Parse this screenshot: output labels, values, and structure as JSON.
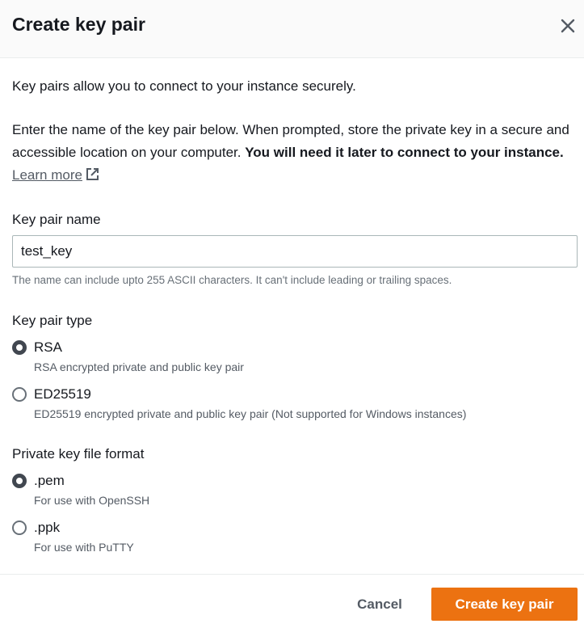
{
  "dialog": {
    "title": "Create key pair",
    "intro": "Key pairs allow you to connect to your instance securely.",
    "description_plain": "Enter the name of the key pair below. When prompted, store the private key in a secure and accessible location on your computer. ",
    "description_bold": "You will need it later to connect to your instance.",
    "learn_more": "Learn more"
  },
  "key_pair_name": {
    "label": "Key pair name",
    "value": "test_key",
    "hint": "The name can include upto 255 ASCII characters. It can't include leading or trailing spaces."
  },
  "key_pair_type": {
    "label": "Key pair type",
    "options": [
      {
        "label": "RSA",
        "description": "RSA encrypted private and public key pair",
        "selected": true
      },
      {
        "label": "ED25519",
        "description": "ED25519 encrypted private and public key pair (Not supported for Windows instances)",
        "selected": false
      }
    ]
  },
  "file_format": {
    "label": "Private key file format",
    "options": [
      {
        "label": ".pem",
        "description": "For use with OpenSSH",
        "selected": true
      },
      {
        "label": ".ppk",
        "description": "For use with PuTTY",
        "selected": false
      }
    ]
  },
  "footer": {
    "cancel_label": "Cancel",
    "create_label": "Create key pair"
  },
  "icons": {
    "close": "close-icon",
    "external_link": "external-link-icon"
  },
  "colors": {
    "primary_button": "#ec7211",
    "radio_checked": "#414750"
  }
}
